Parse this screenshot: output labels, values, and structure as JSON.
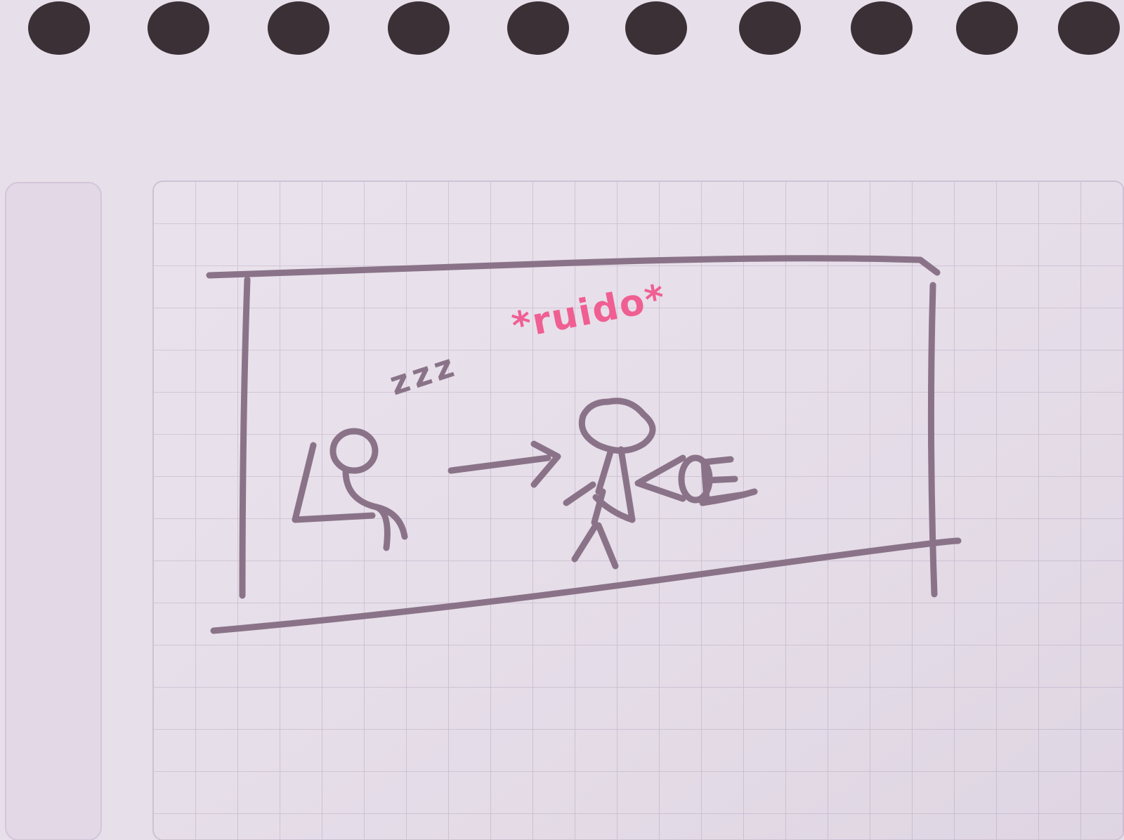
{
  "sketch": {
    "sleep_sound": "zzz",
    "noise_label": "*ruido*"
  },
  "colors": {
    "paper": "#e7dfea",
    "grid": "#c6b8cd",
    "ink": "#8a7388",
    "highlight": "#ef5f92",
    "spiral": "#3a3036"
  }
}
